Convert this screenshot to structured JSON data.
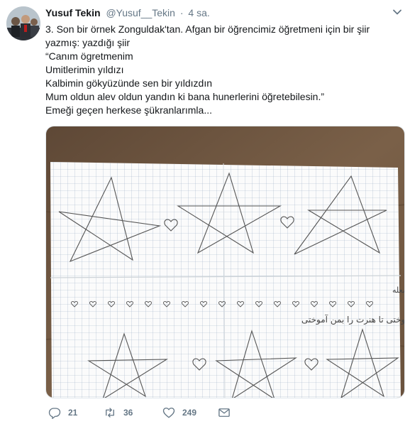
{
  "tweet": {
    "author_name": "Yusuf Tekin",
    "author_handle": "@Yusuf__Tekin",
    "separator": "·",
    "time": "4 sa.",
    "text_lines": [
      "3. Son bir örnek Zonguldak'tan. Afgan bir öğrencimiz öğretmeni için bir şiir",
      "yazmış: yazdığı şiir",
      "“Canım ögretmenim",
      "Umitlerimin yıldızı",
      "Kalbimin gökyüzünde sen bir yıldızdın",
      "Mum oldun alev oldun yandın ki bana hunerlerini öğretebilesin.”",
      "Emeği geçen herkese şükranlarımla..."
    ]
  },
  "media": {
    "handwritten_line_1": "معلم عزیزم ستاره امیدم در آسمان قلبم تو یک ستاره بودی شمع شدی شعله",
    "handwritten_line_2": "شدی سوختی تا هنرت را بمن آموختی"
  },
  "actions": {
    "reply_count": "21",
    "retweet_count": "36",
    "like_count": "249"
  },
  "colors": {
    "text": "#14171a",
    "secondary": "#657786",
    "paper": "#fbfbfb",
    "grid": "#9fb3c8",
    "table": "#6d5640"
  },
  "icons": {
    "reply": "reply-icon",
    "retweet": "retweet-icon",
    "like": "heart-icon",
    "dm": "envelope-icon",
    "caret": "chevron-down-icon"
  }
}
